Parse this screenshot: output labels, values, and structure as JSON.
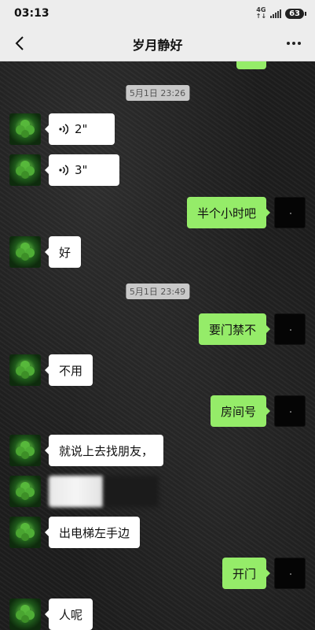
{
  "status_bar": {
    "time": "03:13",
    "network": "4G",
    "battery": "63"
  },
  "header": {
    "title": "岁月静好"
  },
  "timestamps": [
    "5月1日 23:26",
    "5月1日 23:49"
  ],
  "messages": [
    {
      "side": "in",
      "type": "voice",
      "text": "2\""
    },
    {
      "side": "in",
      "type": "voice",
      "text": "3\""
    },
    {
      "side": "out",
      "type": "text",
      "text": "半个小时吧"
    },
    {
      "side": "in",
      "type": "text",
      "text": "好"
    },
    {
      "side": "out",
      "type": "text",
      "text": "要门禁不"
    },
    {
      "side": "in",
      "type": "text",
      "text": "不用"
    },
    {
      "side": "out",
      "type": "text",
      "text": "房间号"
    },
    {
      "side": "in",
      "type": "text",
      "text": "就说上去找朋友，"
    },
    {
      "side": "in",
      "type": "blurred",
      "text": ""
    },
    {
      "side": "in",
      "type": "text",
      "text": "出电梯左手边"
    },
    {
      "side": "out",
      "type": "text",
      "text": "开门"
    },
    {
      "side": "in",
      "type": "text",
      "text": "人呢"
    }
  ],
  "colors": {
    "outgoing": "#95ec69",
    "incoming": "#ffffff",
    "nav_bg": "#ededed"
  }
}
